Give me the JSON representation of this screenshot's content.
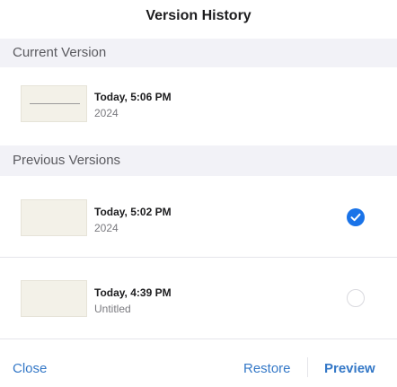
{
  "window": {
    "title": "Version History"
  },
  "sections": {
    "current": {
      "header": "Current Version",
      "item": {
        "time": "Today, 5:06 PM",
        "subtitle": "2024"
      }
    },
    "previous": {
      "header": "Previous Versions",
      "items": [
        {
          "time": "Today, 5:02 PM",
          "subtitle": "2024",
          "selected": true
        },
        {
          "time": "Today, 4:39 PM",
          "subtitle": "Untitled",
          "selected": false
        }
      ]
    }
  },
  "footer": {
    "close_label": "Close",
    "restore_label": "Restore",
    "preview_label": "Preview"
  },
  "colors": {
    "accent": "#3478c7",
    "selected_check": "#1a73e8",
    "section_background": "#f2f2f7"
  }
}
